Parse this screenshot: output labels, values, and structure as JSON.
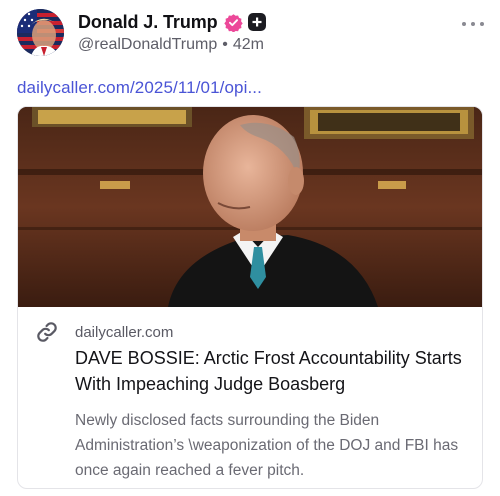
{
  "author": {
    "display_name": "Donald J. Trump",
    "handle": "@realDonaldTrump",
    "separator": "•",
    "time_ago": "42m"
  },
  "post": {
    "link_text": "dailycaller.com/2025/11/01/opi..."
  },
  "card": {
    "domain": "dailycaller.com",
    "title": "DAVE BOSSIE: Arctic Frost Accountability Starts With Impeaching Judge Boasberg",
    "description": "Newly disclosed facts surrounding the Biden Administration’s \\weaponization of the DOJ and FBI has once again reached a fever pitch."
  },
  "icons": {
    "verified": "verified-badge-icon",
    "plus": "plus-badge-icon",
    "more": "more-options-icon",
    "link": "link-icon"
  },
  "colors": {
    "link": "#4a54d6",
    "verified": "#ec4899",
    "text_primary": "#101014",
    "text_secondary": "#5e5e68"
  }
}
